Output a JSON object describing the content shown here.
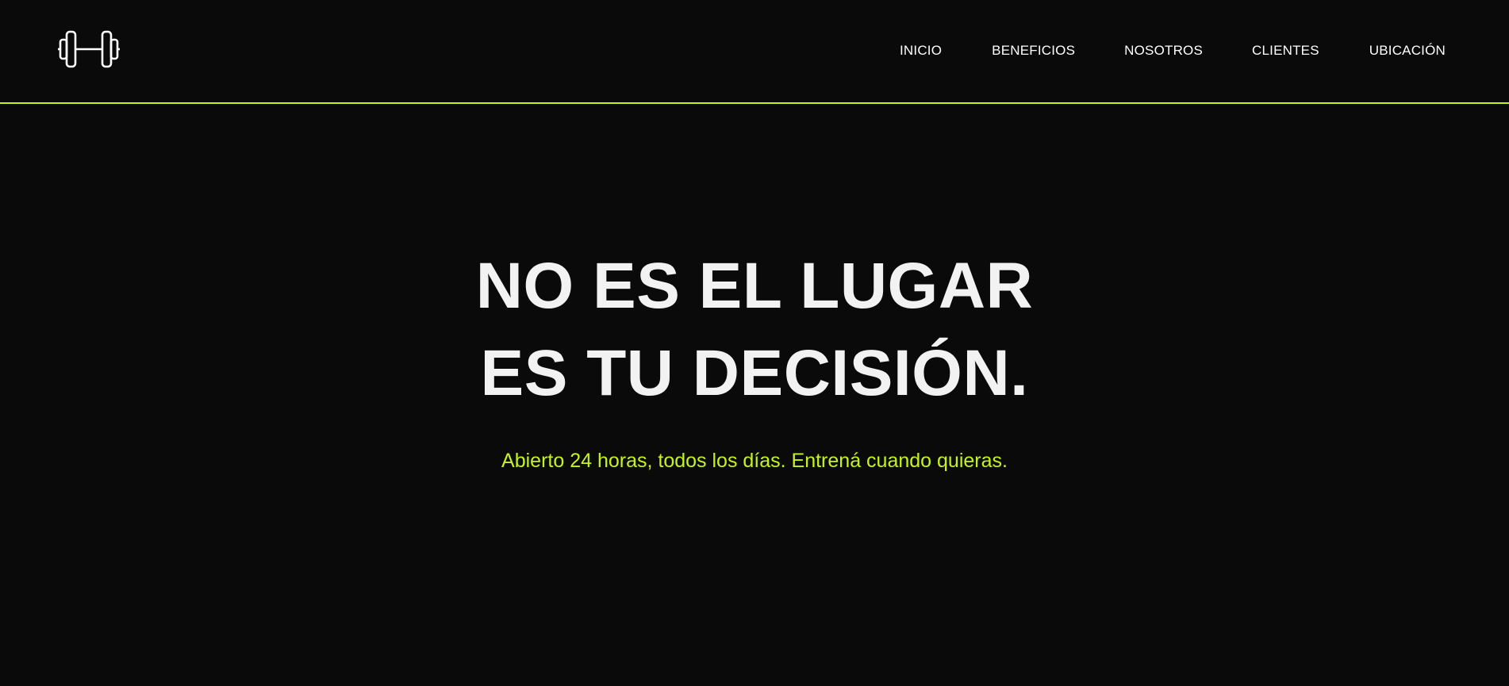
{
  "header": {
    "logo_icon": "dumbbell-icon",
    "nav": [
      {
        "label": "INICIO"
      },
      {
        "label": "BENEFICIOS"
      },
      {
        "label": "NOSOTROS"
      },
      {
        "label": "CLIENTES"
      },
      {
        "label": "UBICACIÓN"
      }
    ]
  },
  "hero": {
    "title_line1": "NO ES EL LUGAR",
    "title_line2": "ES TU DECISIÓN.",
    "subtitle": "Abierto 24 horas, todos los días. Entrená cuando quieras."
  },
  "colors": {
    "background": "#0a0a0a",
    "accent": "#c6f31a",
    "text": "#f2f2f2"
  }
}
